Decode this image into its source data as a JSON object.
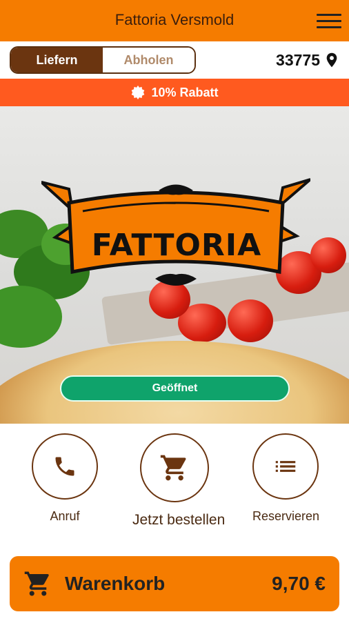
{
  "header": {
    "title": "Fattoria Versmold",
    "menu_icon": "hamburger-menu-icon"
  },
  "mode_toggle": {
    "options": [
      "Liefern",
      "Abholen"
    ],
    "selected": "Liefern"
  },
  "location": {
    "zip": "33775",
    "icon": "location-pin-icon"
  },
  "discount_banner": {
    "text": "10% Rabatt",
    "icon": "discount-badge-icon"
  },
  "hero": {
    "logo_text": "FATTORIA",
    "status_label": "Geöffnet"
  },
  "actions": [
    {
      "label": "Anruf",
      "icon": "phone-icon"
    },
    {
      "label": "Jetzt bestellen",
      "icon": "shopping-cart-icon"
    },
    {
      "label": "Reservieren",
      "icon": "list-icon"
    }
  ],
  "cart": {
    "label": "Warenkorb",
    "total": "9,70 €",
    "icon": "shopping-cart-icon"
  },
  "colors": {
    "primary": "#f57c00",
    "accent": "#ff5a1f",
    "brown": "#6b3510",
    "open_green": "#0fa36b"
  }
}
